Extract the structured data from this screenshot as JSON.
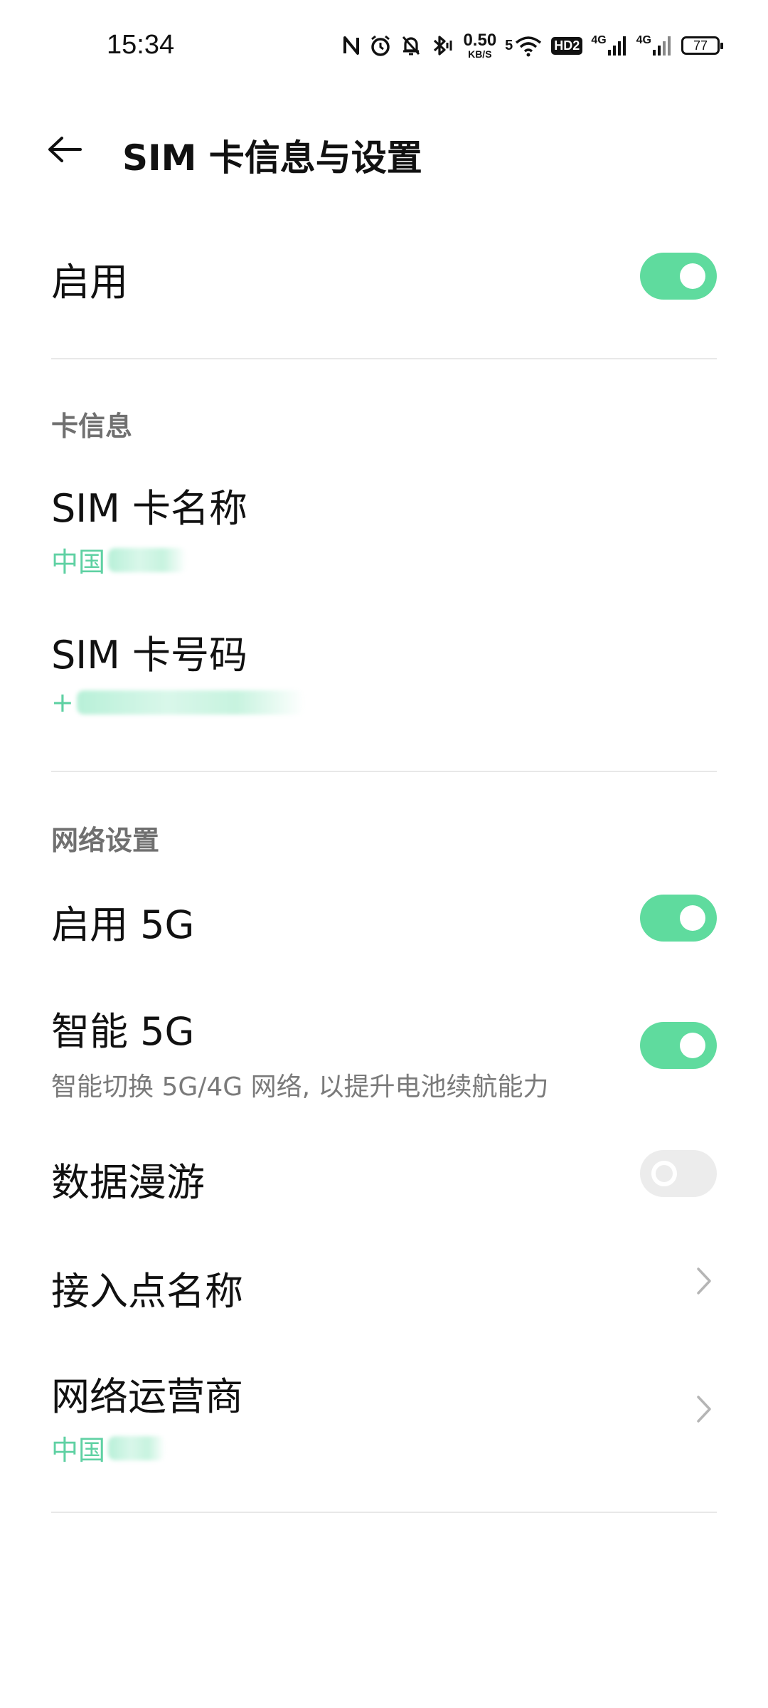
{
  "status_bar": {
    "time": "15:34",
    "net_speed_value": "0.50",
    "net_speed_unit": "KB/S",
    "wifi_label": "5",
    "hd_label": "HD2",
    "sig1_label": "4G",
    "sig2_label": "4G",
    "battery": "77",
    "icons": [
      "nfc-icon",
      "alarm-icon",
      "mute-bell-icon",
      "bluetooth-icon",
      "wifi-icon",
      "hd-icon",
      "signal-icon",
      "signal-icon",
      "battery-icon"
    ]
  },
  "header": {
    "title": "SIM 卡信息与设置"
  },
  "enable": {
    "label": "启用",
    "on": true
  },
  "card_info": {
    "section_title": "卡信息",
    "name_label": "SIM 卡名称",
    "name_value": "中国",
    "number_label": "SIM 卡号码",
    "number_value": "+"
  },
  "network": {
    "section_title": "网络设置",
    "enable_5g_label": "启用 5G",
    "enable_5g_on": true,
    "smart_5g_label": "智能 5G",
    "smart_5g_desc": "智能切换 5G/4G 网络, 以提升电池续航能力",
    "smart_5g_on": true,
    "roaming_label": "数据漫游",
    "roaming_on": false,
    "apn_label": "接入点名称",
    "operator_label": "网络运营商",
    "operator_value": "中国"
  },
  "colors": {
    "accent": "#5fdb9e",
    "accent_text": "#5fd1a3",
    "toggle_off": "#ececec"
  }
}
